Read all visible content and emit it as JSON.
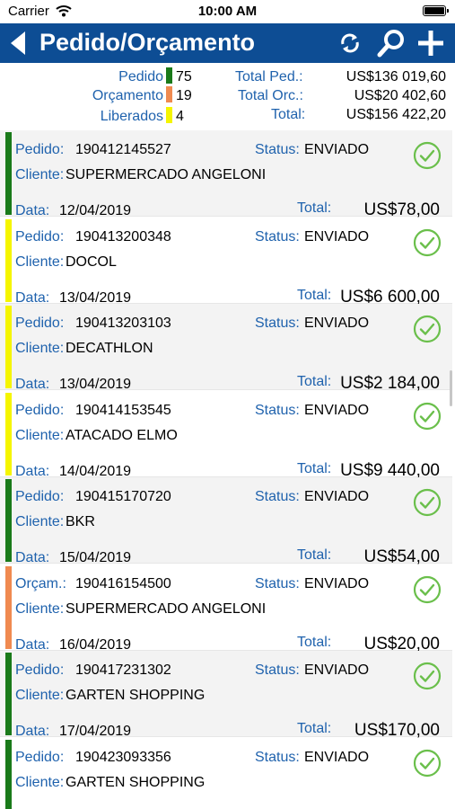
{
  "status_bar": {
    "carrier": "Carrier",
    "time": "10:00 AM"
  },
  "header": {
    "title": "Pedido/Orçamento"
  },
  "summary": {
    "counts": [
      {
        "label": "Pedido",
        "color": "#1a7a1a",
        "count": "75"
      },
      {
        "label": "Orçamento",
        "color": "#f08a50",
        "count": "19"
      },
      {
        "label": "Liberados",
        "color": "#f5f500",
        "count": "4"
      }
    ],
    "totals": [
      {
        "label": "Total Ped.:",
        "value": "US$136 019,60"
      },
      {
        "label": "Total Orc.:",
        "value": "US$20 402,60"
      },
      {
        "label": "Total:",
        "value": "US$156 422,20"
      }
    ]
  },
  "labels": {
    "client": "Cliente:",
    "status": "Status:",
    "date": "Data:",
    "total": "Total:"
  },
  "orders": [
    {
      "type_label": "Pedido:",
      "number": "190412145527",
      "status": "ENVIADO",
      "client": "SUPERMERCADO ANGELONI",
      "date": "12/04/2019",
      "total": "US$78,00",
      "bar_color": "#1a7a1a"
    },
    {
      "type_label": "Pedido:",
      "number": "190413200348",
      "status": "ENVIADO",
      "client": "DOCOL",
      "date": "13/04/2019",
      "total": "US$6 600,00",
      "bar_color": "#f5f500"
    },
    {
      "type_label": "Pedido:",
      "number": "190413203103",
      "status": "ENVIADO",
      "client": "DECATHLON",
      "date": "13/04/2019",
      "total": "US$2 184,00",
      "bar_color": "#f5f500"
    },
    {
      "type_label": "Pedido:",
      "number": "190414153545",
      "status": "ENVIADO",
      "client": "ATACADO ELMO",
      "date": "14/04/2019",
      "total": "US$9 440,00",
      "bar_color": "#f5f500"
    },
    {
      "type_label": "Pedido:",
      "number": "190415170720",
      "status": "ENVIADO",
      "client": "BKR",
      "date": "15/04/2019",
      "total": "US$54,00",
      "bar_color": "#1a7a1a"
    },
    {
      "type_label": "Orçam.:",
      "number": "190416154500",
      "status": "ENVIADO",
      "client": "SUPERMERCADO ANGELONI",
      "date": "16/04/2019",
      "total": "US$20,00",
      "bar_color": "#f08a50"
    },
    {
      "type_label": "Pedido:",
      "number": "190417231302",
      "status": "ENVIADO",
      "client": "GARTEN SHOPPING",
      "date": "17/04/2019",
      "total": "US$170,00",
      "bar_color": "#1a7a1a"
    },
    {
      "type_label": "Pedido:",
      "number": "190423093356",
      "status": "ENVIADO",
      "client": "GARTEN SHOPPING",
      "date": "",
      "total": "",
      "bar_color": "#1a7a1a"
    }
  ]
}
